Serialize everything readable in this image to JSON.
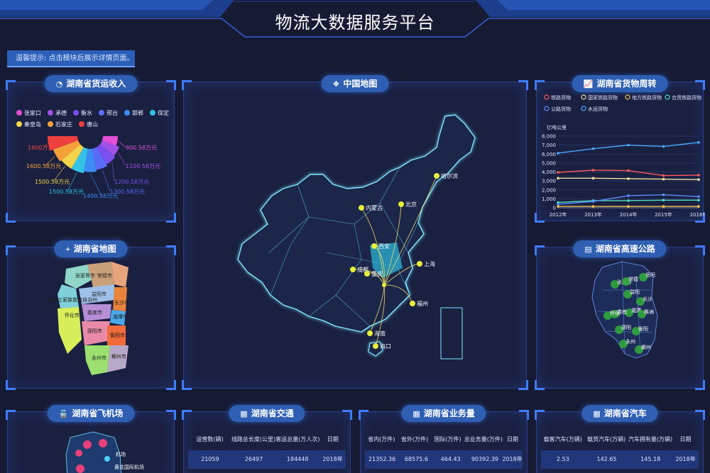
{
  "header": {
    "title": "物流大数据服务平台"
  },
  "notice": "温馨提示: 点击模块后展示详情页面。",
  "panels": {
    "revenue": {
      "title": "湖南省货运收入",
      "icon": "pie-chart-icon"
    },
    "china_map": {
      "title": "中国地图",
      "icon": "china-map-icon"
    },
    "turnover": {
      "title": "湖南省货物周转",
      "icon": "line-chart-icon"
    },
    "hunan_map": {
      "title": "湖南省地图",
      "icon": "location-icon"
    },
    "highway": {
      "title": "湖南省高速公路",
      "icon": "document-icon"
    },
    "airport": {
      "title": "湖南省飞机场",
      "icon": "train-icon"
    },
    "traffic": {
      "title": "湖南省交通",
      "icon": "bar-chart-icon"
    },
    "business": {
      "title": "湖南省业务量",
      "icon": "bar-chart-icon"
    },
    "cars": {
      "title": "湖南省汽车",
      "icon": "bar-chart-icon"
    }
  },
  "revenue_legend": [
    {
      "name": "张家口",
      "color": "#e34fd6"
    },
    {
      "name": "承德",
      "color": "#a150e8"
    },
    {
      "name": "衡水",
      "color": "#7a4ef0"
    },
    {
      "name": "邢台",
      "color": "#5a6cf5"
    },
    {
      "name": "邯郸",
      "color": "#3b8df5"
    },
    {
      "name": "保定",
      "color": "#34c3e6"
    },
    {
      "name": "秦皇岛",
      "color": "#f2d34a"
    },
    {
      "name": "石家庄",
      "color": "#f5a13a"
    },
    {
      "name": "唐山",
      "color": "#ef4040"
    }
  ],
  "chart_data": [
    {
      "type": "pie",
      "title": "湖南省货运收入",
      "categories": [
        "唐山",
        "石家庄",
        "秦皇岛",
        "保定",
        "邯郸",
        "邢台",
        "衡水",
        "承德",
        "张家口"
      ],
      "values": [
        1800.58,
        1600.58,
        1500.58,
        1500.58,
        1400.58,
        1300.58,
        1200.58,
        1100.58,
        900.58
      ],
      "value_labels": [
        "1800万元",
        "1600.58万元",
        "1500.58万元",
        "1500.58万元",
        "1400.58万元",
        "1300.58万元",
        "1200.58万元",
        "1100.58万元",
        "900.58万元"
      ],
      "colors": [
        "#ef4040",
        "#f5a13a",
        "#f2d34a",
        "#34c3e6",
        "#3b8df5",
        "#5a6cf5",
        "#7a4ef0",
        "#a150e8",
        "#e34fd6"
      ]
    },
    {
      "type": "line",
      "title": "湖南省货物周转",
      "ylabel": "亿吨公里",
      "categories": [
        "2012年",
        "2013年",
        "2014年",
        "2015年",
        "2016年"
      ],
      "ylim": [
        0,
        8000
      ],
      "yticks": [
        "0",
        "1,000",
        "2,000",
        "3,000",
        "4,000",
        "5,000",
        "6,000",
        "7,000",
        "8,000"
      ],
      "series": [
        {
          "name": "铁路货物",
          "color": "#ff5a5a",
          "values": [
            3950,
            4200,
            4150,
            3600,
            3650
          ]
        },
        {
          "name": "国家铁路货物",
          "color": "#f2e2a0",
          "values": [
            3300,
            3300,
            3250,
            3200,
            3150
          ]
        },
        {
          "name": "地方铁路货物",
          "color": "#f5c542",
          "values": [
            150,
            150,
            150,
            150,
            150
          ]
        },
        {
          "name": "合资铁路货物",
          "color": "#4fe0c2",
          "values": [
            600,
            800,
            800,
            850,
            850
          ]
        },
        {
          "name": "公路货物",
          "color": "#5a8cff",
          "values": [
            400,
            700,
            1350,
            1450,
            1250
          ]
        },
        {
          "name": "水运货物",
          "color": "#4aa8ff",
          "values": [
            6100,
            6600,
            7000,
            6850,
            7300
          ]
        }
      ],
      "grid": true
    }
  ],
  "china_cities": [
    {
      "name": "哈尔滨"
    },
    {
      "name": "内蒙古"
    },
    {
      "name": "北京"
    },
    {
      "name": "西安"
    },
    {
      "name": "成都"
    },
    {
      "name": "重庆"
    },
    {
      "name": "上海"
    },
    {
      "name": "福州"
    },
    {
      "name": "海南"
    },
    {
      "name": "海口"
    }
  ],
  "hunan_cities": [
    "张家界市",
    "常德市",
    "益阳市",
    "湘西土家族苗族自治州",
    "怀化市",
    "长沙市",
    "娄底市",
    "湘潭市",
    "邵阳市",
    "衡阳市",
    "永州市",
    "郴州市"
  ],
  "highway_cities": [
    "张家界",
    "常德",
    "岳阳",
    "益阳",
    "长沙",
    "湘潭",
    "株洲",
    "娄底",
    "怀化",
    "邵阳",
    "衡阳",
    "永州",
    "郴州"
  ],
  "airport_labels": [
    "机场",
    "黄花国际机场"
  ],
  "tables": {
    "traffic": {
      "headers": [
        "运营数(辆)",
        "线路总长度(公里)",
        "客运总量(万人次)",
        "日期"
      ],
      "row": [
        "21059",
        "26497",
        "184448",
        "2018年"
      ]
    },
    "business": {
      "headers": [
        "省内(万件)",
        "省外(万件)",
        "国际(万件)",
        "总业务量(万件)",
        "日期"
      ],
      "row": [
        "21352.36",
        "68575.6",
        "464.43",
        "90392.39",
        "2018年"
      ]
    },
    "cars": {
      "headers": [
        "载客汽车(万辆)",
        "载货汽车(万辆)",
        "汽车拥有量(万辆)",
        "日期"
      ],
      "row": [
        "2.53",
        "142.65",
        "145.18",
        "2018年"
      ]
    }
  }
}
